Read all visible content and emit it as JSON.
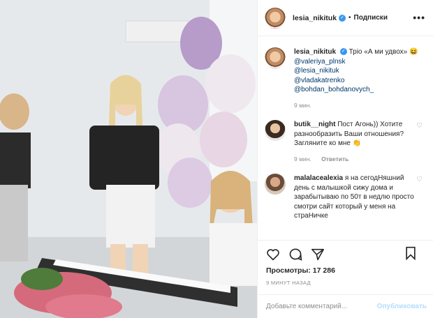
{
  "post": {
    "username": "lesia_nikituk",
    "follow_label": "Подписки",
    "dot": "•",
    "more": "•••"
  },
  "comments": [
    {
      "username": "lesia_nikituk",
      "text": "Тріо «А ми удвох»",
      "emoji": "😆",
      "mentions": [
        "@valeriya_plnsk",
        "@lesia_nikituk",
        "@vladakatrenko",
        "@bohdan_bohdanovych_"
      ],
      "time": "9 мин."
    },
    {
      "username": "butik__night",
      "text": "Пост Агонь)) Хотите разнообразить Ваши отношения? Загляните ко мне",
      "emoji": "👏",
      "time": "9 мин.",
      "reply_label": "Ответить"
    },
    {
      "username": "malalacealexia",
      "text": "я на сегодНяшний день с малышкой сижу дома и зарабытываю по 50т в недлю просто смотри сайт который у меня на страНичке",
      "time": "",
      "reply_label": ""
    }
  ],
  "actions": {
    "views_label": "Просмотры: 17 286",
    "posted_ago": "9 МИНУТ НАЗАД"
  },
  "add_comment": {
    "placeholder": "Добавьте комментарий...",
    "publish_label": "Опубликовать"
  },
  "colors": {
    "link": "#00376b",
    "verified": "#3897f0",
    "publish_disabled": "#b2dffc",
    "muted": "#8e8e8e"
  },
  "icons": [
    "heart-icon",
    "comment-icon",
    "share-icon",
    "bookmark-icon",
    "verified-badge-icon",
    "more-icon"
  ]
}
